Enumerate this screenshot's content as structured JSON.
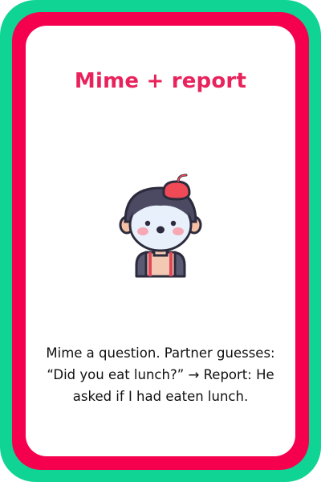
{
  "card": {
    "title": "Mime + report",
    "description": "Mime a question. Partner guesses: “Did you eat lunch?” → Report: He asked if I had eaten lunch.",
    "illustration_icon": "mime-icon"
  },
  "colors": {
    "outer_border": "#10d494",
    "inner_border": "#f5004f",
    "title": "#e8235c",
    "text": "#111111",
    "beret": "#f04a57"
  }
}
